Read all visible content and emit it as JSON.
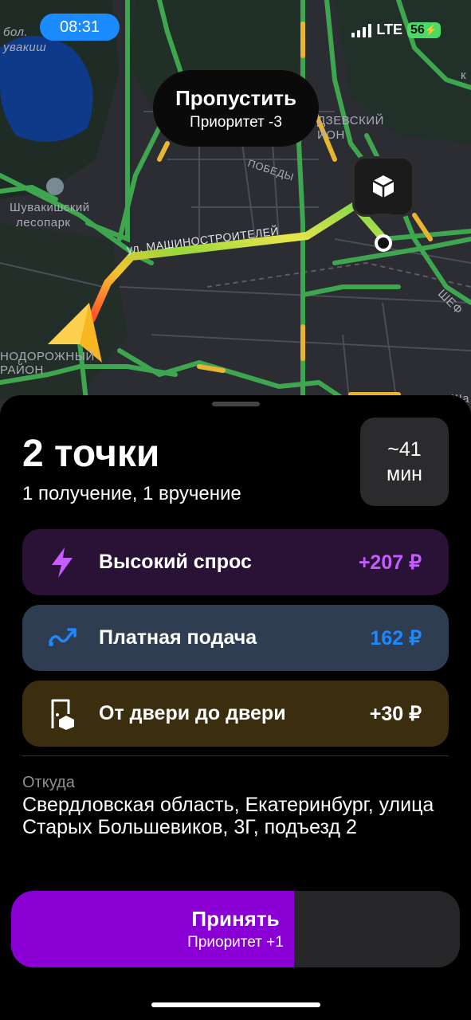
{
  "status_bar": {
    "time": "08:31",
    "network": "LTE",
    "battery": "56"
  },
  "map": {
    "labels": [
      "бол.",
      "увакиш",
      "Шувакишский",
      "лесопарк",
      "ул. МАШИНОСТРОИТЕЛЕЙ",
      "ПОБЕДЫ",
      "ДЗЕВСКИЙ",
      "ЙОН",
      "НОДОРОЖНЫЙ",
      "РАЙОН",
      "ШЕФ",
      "Ша",
      "к"
    ]
  },
  "skip": {
    "label": "Пропустить",
    "priority": "Приоритет -3"
  },
  "order": {
    "title": "2 точки",
    "subtitle": "1 получение, 1 вручение",
    "eta_value": "~41",
    "eta_unit": "мин"
  },
  "bonuses": [
    {
      "icon": "lightning-icon",
      "label": "Высокий спрос",
      "amount": "+207 ₽",
      "color": "#c45cff"
    },
    {
      "icon": "route-icon",
      "label": "Платная подача",
      "amount": "162 ₽",
      "color": "#1e88ff"
    },
    {
      "icon": "door-package-icon",
      "label": "От двери до двери",
      "amount": "+30 ₽",
      "color": "#ffffff"
    }
  ],
  "from": {
    "label": "Откуда",
    "address": "Свердловская область, Екатеринбург, улица Старых Большевиков, 3Г, подъезд 2"
  },
  "accept": {
    "label": "Принять",
    "priority": "Приоритет +1",
    "progress": 0.63
  }
}
